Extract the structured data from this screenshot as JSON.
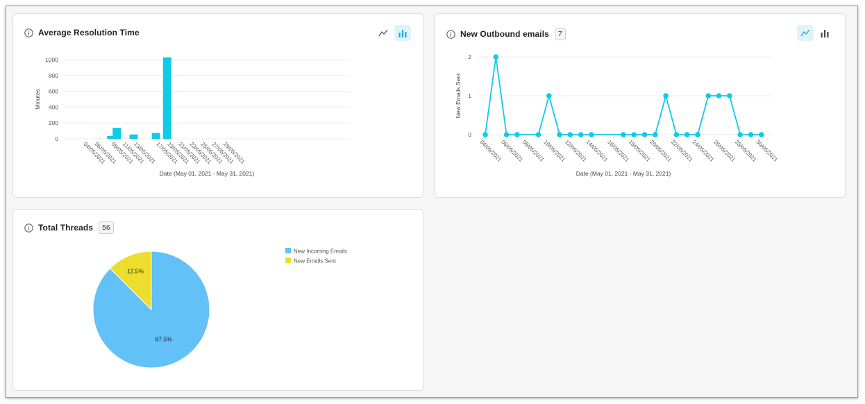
{
  "colors": {
    "series": "#0fcbe8",
    "pie_incoming": "#62c1f7",
    "pie_sent": "#eddd2c",
    "active_toggle_bg": "#dff3fb",
    "active_toggle_icon": "#1fa6d6"
  },
  "icons": {
    "info": "info-circle-icon",
    "line_toggle": "line-chart-icon",
    "bar_toggle": "bar-chart-icon"
  },
  "cards": {
    "resolution": {
      "title": "Average Resolution Time",
      "active_view": "bar"
    },
    "outbound": {
      "title": "New Outbound emails",
      "count": "7",
      "active_view": "line"
    },
    "threads": {
      "title": "Total Threads",
      "count": "56"
    }
  },
  "chart_data": [
    {
      "type": "bar",
      "title": "",
      "xlabel": "Date (May 01, 2021 - May 31, 2021)",
      "ylabel": "Minutes",
      "ylim": [
        0,
        1000
      ],
      "yticks": [
        0,
        200,
        400,
        600,
        800,
        1000
      ],
      "grid": true,
      "xtick_labels": [
        "04/05/2021",
        "06/05/2021",
        "09/05/2021",
        "11/05/2021",
        "13/05/2021",
        "17/05/2021",
        "19/05/2021",
        "21/05/2021",
        "23/05/2021",
        "25/05/2021",
        "27/05/2021",
        "29/05/2021"
      ],
      "categories": [
        "09/05/2021",
        "10/05/2021",
        "13/05/2021",
        "17/05/2021",
        "19/05/2021"
      ],
      "values": [
        35,
        140,
        55,
        75,
        1030
      ]
    },
    {
      "type": "line",
      "title": "",
      "xlabel": "Date (May 01, 2021 - May 31, 2021)",
      "ylabel": "New Emails Sent",
      "ylim": [
        0,
        2
      ],
      "yticks": [
        0,
        1,
        2
      ],
      "grid": true,
      "xtick_labels": [
        "04/05/2021",
        "06/05/2021",
        "08/05/2021",
        "10/05/2021",
        "12/05/2021",
        "14/05/2021",
        "16/05/2021",
        "18/05/2021",
        "20/05/2021",
        "22/05/2021",
        "24/05/2021",
        "26/05/2021",
        "28/05/2021",
        "30/05/2021"
      ],
      "x": [
        "04/05/2021",
        "05/05/2021",
        "06/05/2021",
        "07/05/2021",
        "09/05/2021",
        "10/05/2021",
        "11/05/2021",
        "12/05/2021",
        "13/05/2021",
        "14/05/2021",
        "17/05/2021",
        "18/05/2021",
        "19/05/2021",
        "20/05/2021",
        "21/05/2021",
        "22/05/2021",
        "23/05/2021",
        "24/05/2021",
        "25/05/2021",
        "26/05/2021",
        "27/05/2021",
        "28/05/2021",
        "29/05/2021",
        "30/05/2021"
      ],
      "values": [
        0,
        2,
        0,
        0,
        0,
        1,
        0,
        0,
        0,
        0,
        0,
        0,
        0,
        0,
        1,
        0,
        0,
        0,
        1,
        1,
        1,
        0,
        0,
        0
      ]
    },
    {
      "type": "pie",
      "title": "",
      "legend": "top-right",
      "labels": [
        "New Incoming Emails",
        "New Emails Sent"
      ],
      "values": [
        87.5,
        12.5
      ],
      "display_labels": [
        "87.5%",
        "12.5%"
      ]
    }
  ]
}
